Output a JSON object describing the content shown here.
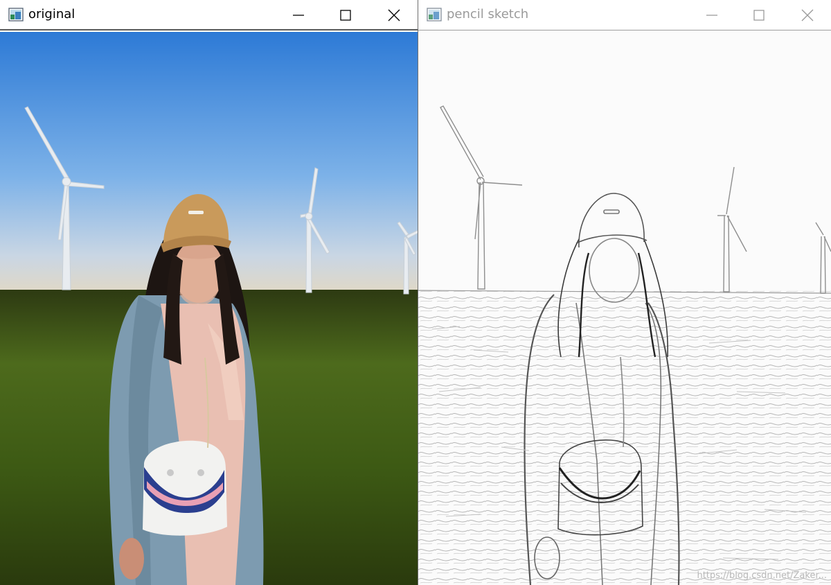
{
  "windows": [
    {
      "id": "original",
      "title": "original",
      "active": true,
      "controls": [
        "minimize-icon",
        "maximize-icon",
        "close-icon"
      ]
    },
    {
      "id": "sketch",
      "title": "pencil sketch",
      "active": false,
      "controls": [
        "minimize-icon",
        "maximize-icon",
        "close-icon"
      ]
    }
  ],
  "watermark": "https://blog.csdn.net/Zaker...",
  "colors": {
    "sky_top": "#2f7fd6",
    "sky_bottom": "#d9d8d2",
    "grass": "#3c5a16",
    "cap": "#c99a5b",
    "cardigan": "#7f9cb0",
    "shirt": "#e7bdb1",
    "inactive_title": "#9a9a9a"
  }
}
